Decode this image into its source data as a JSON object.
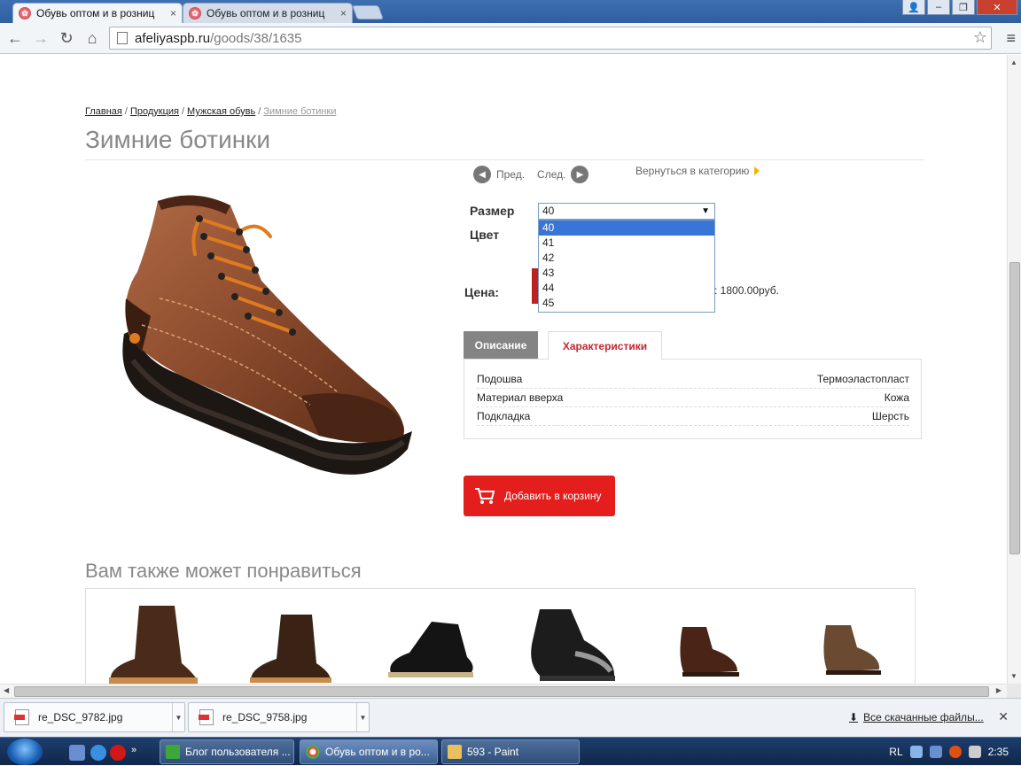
{
  "browser": {
    "tabs": [
      {
        "title": "Обувь оптом и в розниц",
        "active": true
      },
      {
        "title": "Обувь оптом и в розниц",
        "active": false
      }
    ],
    "url_domain": "afeliyaspb.ru",
    "url_path": "/goods/38/1635"
  },
  "page": {
    "breadcrumb": [
      "Главная",
      "Продукция",
      "Мужская обувь",
      "Зимние ботинки"
    ],
    "title": "Зимние ботинки",
    "pager": {
      "prev": "Пред.",
      "next": "След."
    },
    "back_link": "Вернуться в категорию",
    "size_label": "Размер",
    "color_label": "Цвет",
    "price_label": "Цена:",
    "price_text": ": 1800.00руб.",
    "size_select": {
      "value": "40",
      "options": [
        "40",
        "41",
        "42",
        "43",
        "44",
        "45"
      ],
      "highlighted": "40"
    },
    "tabs": {
      "description": "Описание",
      "characteristics": "Характеристики",
      "active": "Характеристики"
    },
    "specs": [
      {
        "name": "Подошва",
        "value": "Термоэластопласт"
      },
      {
        "name": "Материал вверха",
        "value": "Кожа"
      },
      {
        "name": "Подкладка",
        "value": "Шерсть"
      }
    ],
    "add_to_cart": "Добавить в корзину",
    "also_like_title": "Вам также может понравиться",
    "accent_color": "#e41d1d"
  },
  "downloads": {
    "items": [
      "re_DSC_9782.jpg",
      "re_DSC_9758.jpg"
    ],
    "all_link": "Все скачанные файлы..."
  },
  "taskbar": {
    "items": [
      "Блог пользователя ...",
      "Обувь оптом и в ро...",
      "593 - Paint"
    ],
    "lang": "RL",
    "time": "2:35"
  }
}
